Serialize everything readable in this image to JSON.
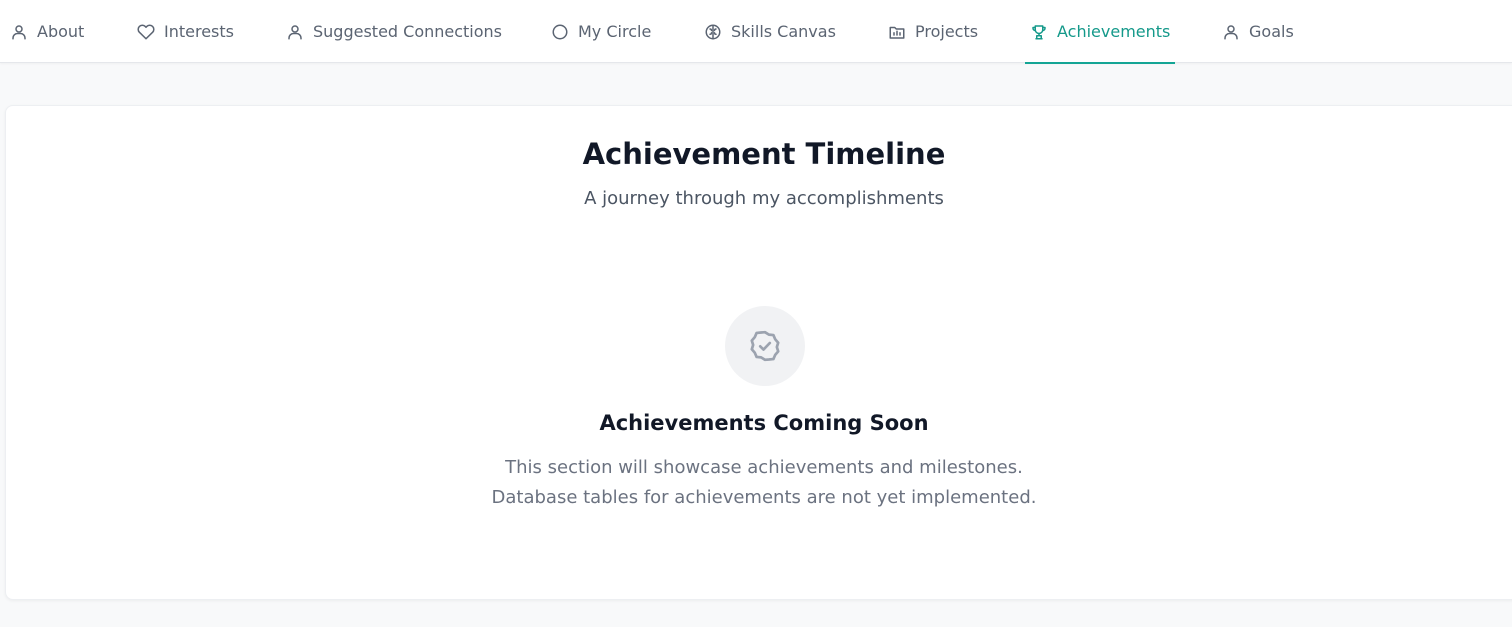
{
  "nav": {
    "tabs": [
      {
        "label": "About",
        "icon": "user-icon"
      },
      {
        "label": "Interests",
        "icon": "heart-icon"
      },
      {
        "label": "Suggested Connections",
        "icon": "user-icon"
      },
      {
        "label": "My Circle",
        "icon": "circle-icon"
      },
      {
        "label": "Skills Canvas",
        "icon": "brain-icon"
      },
      {
        "label": "Projects",
        "icon": "chart-bar-icon"
      },
      {
        "label": "Achievements",
        "icon": "trophy-icon",
        "active": true
      },
      {
        "label": "Goals",
        "icon": "user-icon"
      }
    ],
    "active_color": "#14998a"
  },
  "section": {
    "title": "Achievement Timeline",
    "subtitle": "A journey through my accomplishments"
  },
  "empty_state": {
    "icon": "badge-check-icon",
    "title": "Achievements Coming Soon",
    "line1": "This section will showcase achievements and milestones.",
    "line2": "Database tables for achievements are not yet implemented."
  }
}
